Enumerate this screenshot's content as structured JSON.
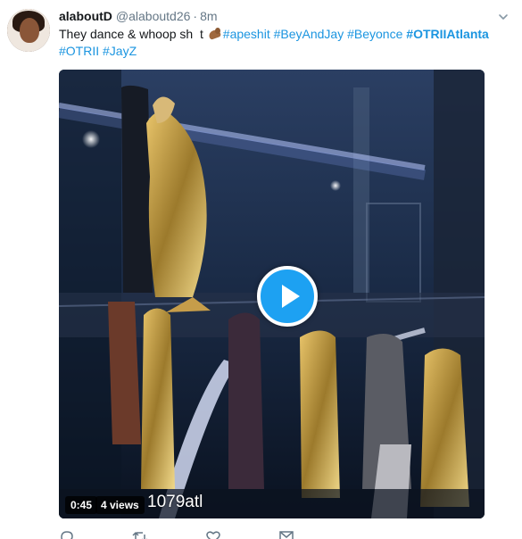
{
  "tweet": {
    "display_name": "alaboutD",
    "handle": "@alaboutd26",
    "separator": "·",
    "time": "8m",
    "text_prefix": "They dance & whoop sh",
    "text_gap_char": "t",
    "hashtags_line1": [
      "#apeshit",
      "#BeyAndJay",
      "#Beyonce"
    ],
    "hashtag_bold": "#OTRIIAtlanta",
    "hashtags_line2": [
      "#OTRII",
      "#JayZ"
    ],
    "caret_icon": "chevron-down-icon",
    "emoji_icon": "flexed-biceps-icon"
  },
  "video": {
    "duration": "0:45",
    "views": "4 views",
    "watermark": "1079atl",
    "play_icon": "play-icon"
  },
  "actions": [
    {
      "name": "reply",
      "icon": "reply-icon"
    },
    {
      "name": "retweet",
      "icon": "retweet-icon"
    },
    {
      "name": "like",
      "icon": "heart-icon"
    },
    {
      "name": "dm",
      "icon": "envelope-icon"
    }
  ],
  "colors": {
    "link": "#1b95e0",
    "play_button": "#1da1f2",
    "secondary_text": "#657786"
  }
}
